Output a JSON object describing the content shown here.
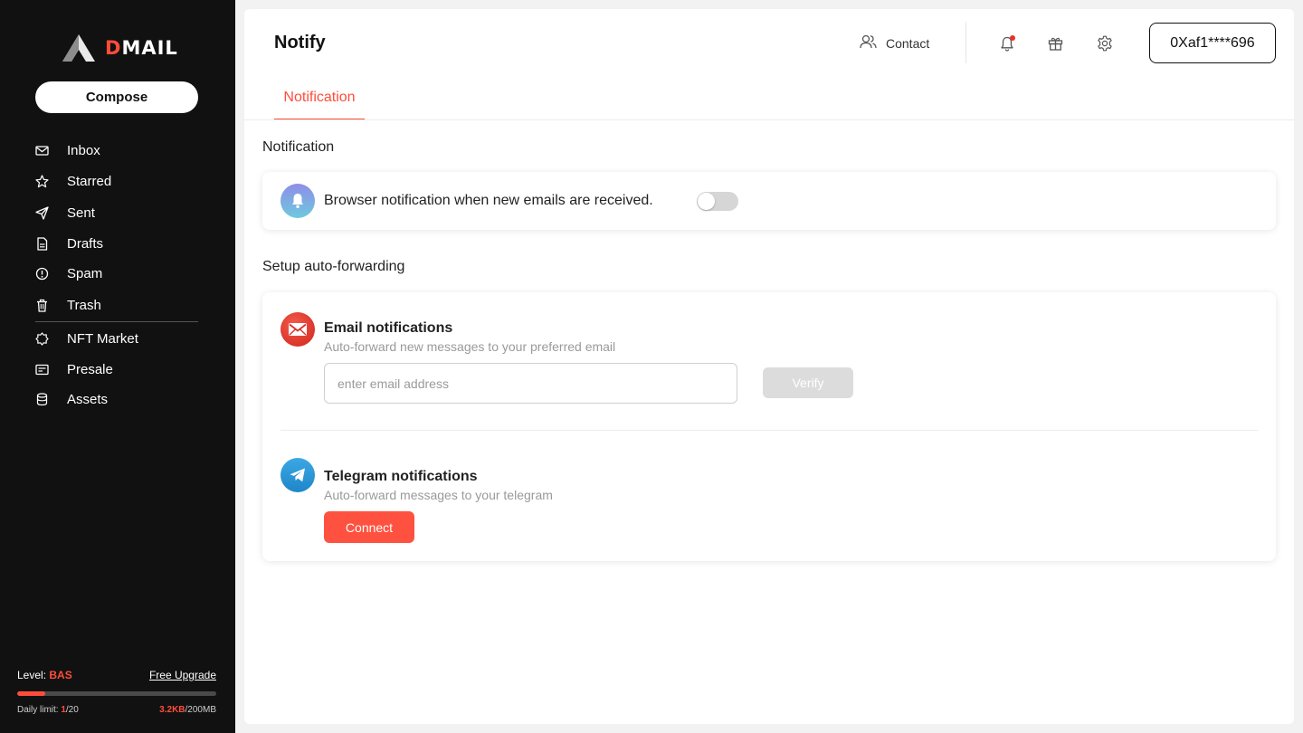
{
  "brand": {
    "logo_prefix": "D",
    "logo_rest": "MAIL",
    "accent_color": "#ff4d3a"
  },
  "sidebar": {
    "compose_label": "Compose",
    "items": [
      {
        "label": "Inbox",
        "icon": "inbox-icon"
      },
      {
        "label": "Starred",
        "icon": "star-icon"
      },
      {
        "label": "Sent",
        "icon": "send-icon"
      },
      {
        "label": "Drafts",
        "icon": "drafts-icon"
      },
      {
        "label": "Spam",
        "icon": "spam-icon"
      },
      {
        "label": "Trash",
        "icon": "trash-icon"
      },
      {
        "label": "NFT Market",
        "icon": "nft-market-icon"
      },
      {
        "label": "Presale",
        "icon": "presale-icon"
      },
      {
        "label": "Assets",
        "icon": "assets-icon"
      }
    ],
    "footer": {
      "level_label": "Level: ",
      "level_value": "BAS",
      "upgrade_label": "Free Upgrade",
      "daily_limit_label": "Daily limit: ",
      "daily_limit_used": "1",
      "daily_limit_total": "/20",
      "storage_used": "3.2KB",
      "storage_total": "/200MB",
      "daily_limit_fraction": 0.05
    }
  },
  "header": {
    "title": "Notify",
    "contact_label": "Contact",
    "icons": [
      "bell-icon",
      "gift-icon",
      "gear-icon"
    ],
    "wallet_address": "0Xaf1****696"
  },
  "tabs": [
    {
      "label": "Notification",
      "active": true
    }
  ],
  "notification_section": {
    "title": "Notification",
    "browser_label": "Browser notification when new emails are received.",
    "browser_enabled": false
  },
  "forwarding_section": {
    "title": "Setup auto-forwarding",
    "email": {
      "title": "Email notifications",
      "subtitle": "Auto-forward new messages to your preferred email",
      "input_placeholder": "enter email address",
      "verify_label": "Verify"
    },
    "telegram": {
      "title": "Telegram notifications",
      "subtitle": "Auto-forward messages to your telegram",
      "connect_label": "Connect"
    }
  }
}
